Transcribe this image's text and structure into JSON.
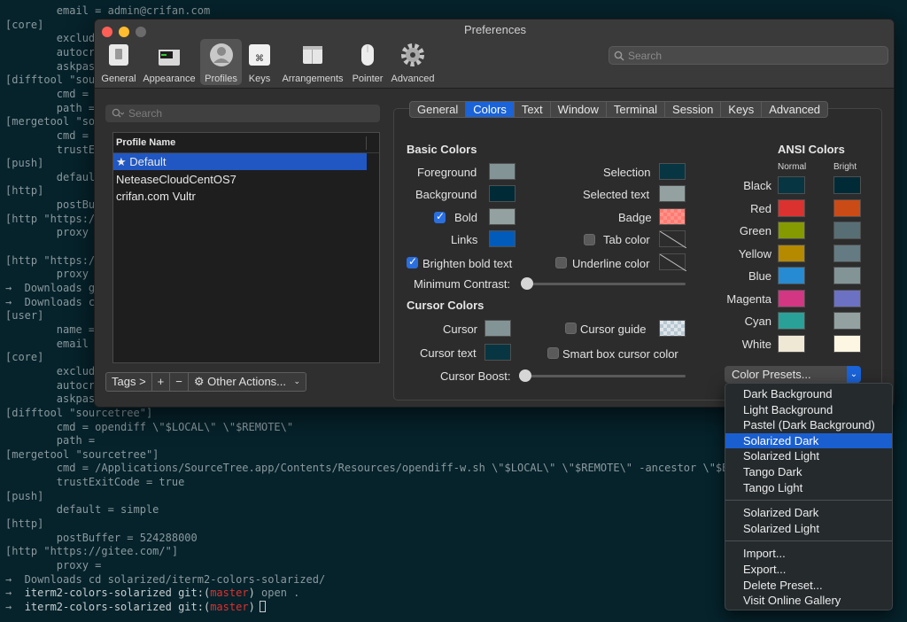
{
  "terminal": {
    "lines": [
      "        email = admin@crifan.com",
      "[core]",
      "        exclude",
      "        autocrl",
      "        askpass",
      "[difftool \"sour",
      "        cmd = o",
      "        path =",
      "[mergetool \"sou",
      "        cmd = /",
      "        trustEx",
      "[push]",
      "        default",
      "[http]",
      "        postBuf",
      "[http \"https://",
      "        proxy =",
      "",
      "[http \"https://",
      "        proxy =",
      "→  Downloads gi",
      "→  Downloads ca",
      "[user]",
      "        name =",
      "        email =",
      "[core]",
      "        exclude",
      "        autocrl",
      "        askpass",
      "[difftool \"sourcetree\"]",
      "        cmd = opendiff \\\"$LOCAL\\\" \\\"$REMOTE\\\"",
      "        path =",
      "[mergetool \"sourcetree\"]",
      "        cmd = /Applications/SourceTree.app/Contents/Resources/opendiff-w.sh \\\"$LOCAL\\\" \\\"$REMOTE\\\" -ancestor \\\"$BASE\\\"",
      "        trustExitCode = true",
      "[push]",
      "        default = simple",
      "[http]",
      "        postBuffer = 524288000",
      "[http \"https://gitee.com/\"]",
      "        proxy =",
      "→  Downloads cd solarized/iterm2-colors-solarized/"
    ],
    "prompt1": {
      "arrow": "→",
      "dir": "iterm2-colors-solarized",
      "git": "git:(",
      "branch": "master",
      "close": ")",
      "cmd": "open ."
    },
    "prompt2": {
      "arrow": "→",
      "dir": "iterm2-colors-solarized",
      "git": "git:(",
      "branch": "master",
      "close": ")"
    }
  },
  "window": {
    "title": "Preferences",
    "toolbar": [
      {
        "label": "General",
        "icon": "general-icon"
      },
      {
        "label": "Appearance",
        "icon": "appearance-icon"
      },
      {
        "label": "Profiles",
        "icon": "profiles-icon"
      },
      {
        "label": "Keys",
        "icon": "keys-icon"
      },
      {
        "label": "Arrangements",
        "icon": "arrangements-icon"
      },
      {
        "label": "Pointer",
        "icon": "pointer-icon"
      },
      {
        "label": "Advanced",
        "icon": "advanced-gear-icon"
      }
    ],
    "search_placeholder": "Search"
  },
  "profiles": {
    "search_placeholder": "Search",
    "header": "Profile Name",
    "items": [
      "★ Default",
      "NeteaseCloudCentOS7",
      "crifan.com Vultr"
    ],
    "tags_label": "Tags >",
    "add": "+",
    "remove": "−",
    "other_actions": "Other Actions..."
  },
  "tabs": [
    "General",
    "Colors",
    "Text",
    "Window",
    "Terminal",
    "Session",
    "Keys",
    "Advanced"
  ],
  "basic": {
    "heading": "Basic Colors",
    "foreground": "Foreground",
    "background": "Background",
    "bold": "Bold",
    "links": "Links",
    "selection": "Selection",
    "selected_text": "Selected text",
    "badge": "Badge",
    "tab_color": "Tab color",
    "underline_color": "Underline color",
    "brighten_bold": "Brighten bold text",
    "min_contrast": "Minimum Contrast:"
  },
  "cursor": {
    "heading": "Cursor Colors",
    "cursor": "Cursor",
    "cursor_text": "Cursor text",
    "cursor_guide": "Cursor guide",
    "smart_box": "Smart box cursor color",
    "boost": "Cursor Boost:"
  },
  "ansi": {
    "heading": "ANSI Colors",
    "normal": "Normal",
    "bright": "Bright",
    "rows": [
      {
        "name": "Black",
        "normal": "#073642",
        "bright": "#002b36"
      },
      {
        "name": "Red",
        "normal": "#dc322f",
        "bright": "#cb4b16"
      },
      {
        "name": "Green",
        "normal": "#859900",
        "bright": "#586e75"
      },
      {
        "name": "Yellow",
        "normal": "#b58900",
        "bright": "#657b83"
      },
      {
        "name": "Blue",
        "normal": "#268bd2",
        "bright": "#839496"
      },
      {
        "name": "Magenta",
        "normal": "#d33682",
        "bright": "#6c71c4"
      },
      {
        "name": "Cyan",
        "normal": "#2aa198",
        "bright": "#93a1a1"
      },
      {
        "name": "White",
        "normal": "#eee8d5",
        "bright": "#fdf6e3"
      }
    ]
  },
  "colors": {
    "foreground": "#839496",
    "background": "#002b36",
    "bold": "#93a1a1",
    "links": "#005bbb",
    "selection": "#073642",
    "selected_text": "#93a1a1",
    "badge": "#ff7b72",
    "cursor": "#839496",
    "cursor_text": "#073642",
    "accent": "#1a63d8"
  },
  "presets": {
    "button": "Color Presets...",
    "group1": [
      "Dark Background",
      "Light Background",
      "Pastel (Dark Background)",
      "Solarized Dark",
      "Solarized Light",
      "Tango Dark",
      "Tango Light"
    ],
    "group2": [
      "Solarized Dark",
      "Solarized Light"
    ],
    "group3": [
      "Import...",
      "Export...",
      "Delete Preset...",
      "Visit Online Gallery"
    ],
    "selected": "Solarized Dark"
  }
}
